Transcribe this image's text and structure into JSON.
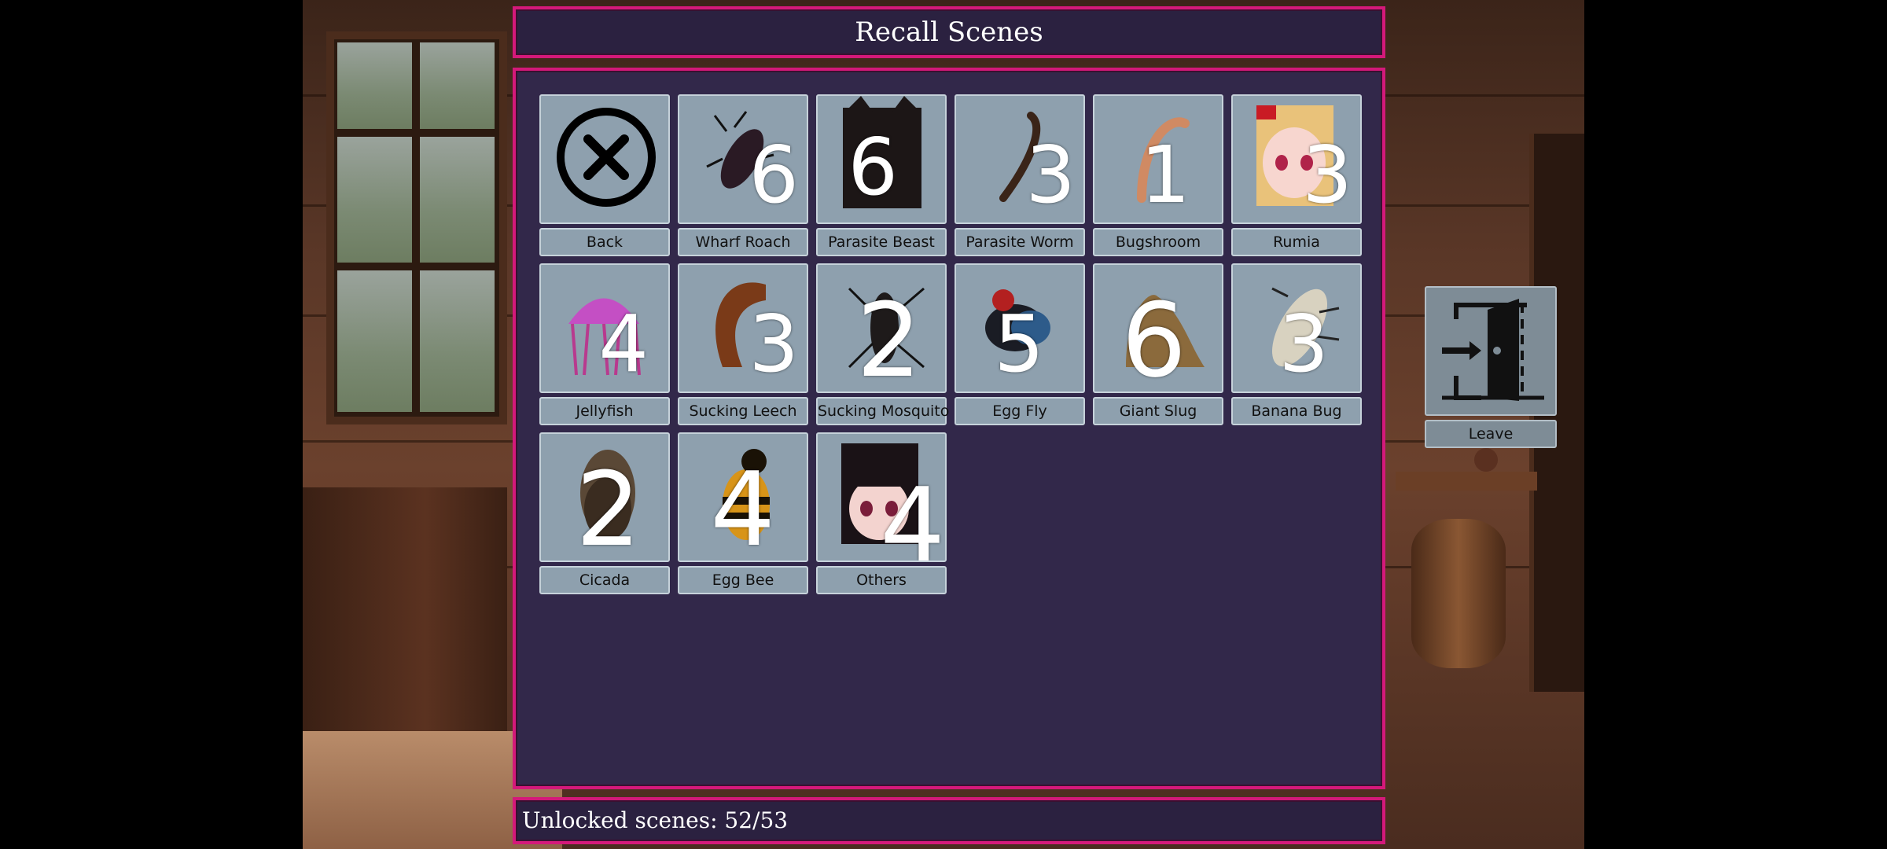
{
  "title": "Recall Scenes",
  "status": {
    "unlocked_label": "Unlocked scenes: 52/53"
  },
  "leave_label": "Leave",
  "tiles": [
    {
      "label": "Back",
      "count": "",
      "icon": "close-circle-icon"
    },
    {
      "label": "Wharf Roach",
      "count": "6",
      "icon": "roach-icon"
    },
    {
      "label": "Parasite Beast",
      "count": "6",
      "icon": "beast-icon"
    },
    {
      "label": "Parasite Worm",
      "count": "3",
      "icon": "worm-icon"
    },
    {
      "label": "Bugshroom",
      "count": "1",
      "icon": "bugshroom-icon"
    },
    {
      "label": "Rumia",
      "count": "3",
      "icon": "rumia-portrait"
    },
    {
      "label": "Jellyfish",
      "count": "4",
      "icon": "jellyfish-icon"
    },
    {
      "label": "Sucking Leech",
      "count": "3",
      "icon": "leech-icon"
    },
    {
      "label": "Sucking Mosquito",
      "count": "2",
      "icon": "mosquito-icon"
    },
    {
      "label": "Egg Fly",
      "count": "5",
      "icon": "fly-icon"
    },
    {
      "label": "Giant Slug",
      "count": "6",
      "icon": "slug-icon"
    },
    {
      "label": "Banana Bug",
      "count": "3",
      "icon": "banana-bug-icon"
    },
    {
      "label": "Cicada",
      "count": "2",
      "icon": "cicada-icon"
    },
    {
      "label": "Egg Bee",
      "count": "4",
      "icon": "bee-icon"
    },
    {
      "label": "Others",
      "count": "4",
      "icon": "others-portrait"
    }
  ],
  "colors": {
    "frame_border": "#d4197a",
    "panel_bg": "#2b2140",
    "tile_bg": "#8ea0ae"
  }
}
